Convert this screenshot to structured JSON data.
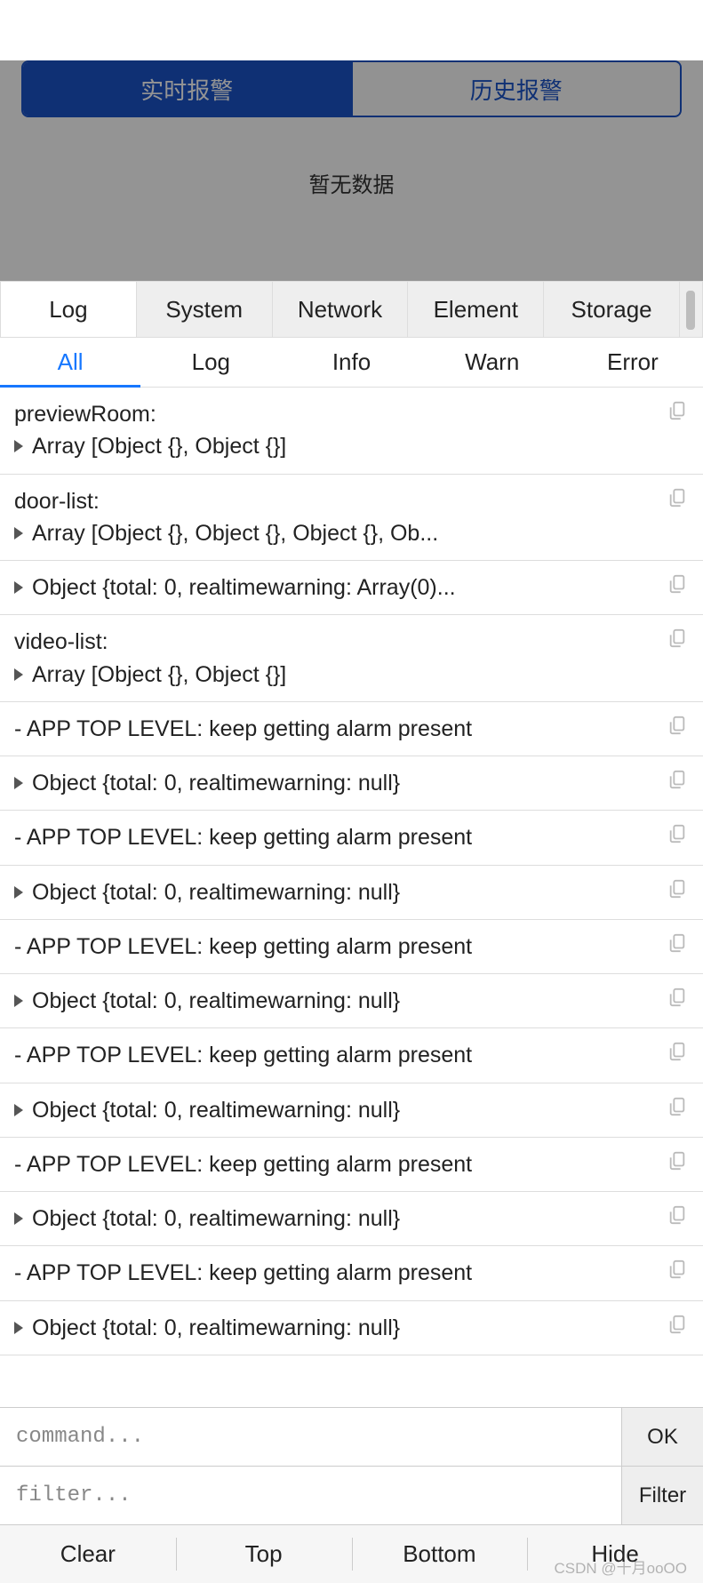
{
  "header": {
    "tabs": [
      "实时报警",
      "历史报警"
    ],
    "activeIndex": 0,
    "noData": "暂无数据"
  },
  "console": {
    "mainTabs": [
      "Log",
      "System",
      "Network",
      "Element",
      "Storage"
    ],
    "mainActiveIndex": 0,
    "subTabs": [
      "All",
      "Log",
      "Info",
      "Warn",
      "Error"
    ],
    "subActiveIndex": 0
  },
  "logs": [
    {
      "label": "previewRoom:",
      "expand": true,
      "body": "Array [Object {}, Object {}]"
    },
    {
      "label": "door-list:",
      "expand": true,
      "body": "Array [Object {}, Object {}, Object {}, Ob..."
    },
    {
      "expand": true,
      "body": "Object {total: 0, realtimewarning: Array(0)..."
    },
    {
      "label": "video-list:",
      "expand": true,
      "body": "Array [Object {}, Object {}]"
    },
    {
      "body": "- APP TOP LEVEL: keep getting alarm present"
    },
    {
      "expand": true,
      "body": "Object {total: 0, realtimewarning: null}"
    },
    {
      "body": "- APP TOP LEVEL: keep getting alarm present"
    },
    {
      "expand": true,
      "body": "Object {total: 0, realtimewarning: null}"
    },
    {
      "body": "- APP TOP LEVEL: keep getting alarm present"
    },
    {
      "expand": true,
      "body": "Object {total: 0, realtimewarning: null}"
    },
    {
      "body": "- APP TOP LEVEL: keep getting alarm present"
    },
    {
      "expand": true,
      "body": "Object {total: 0, realtimewarning: null}"
    },
    {
      "body": "- APP TOP LEVEL: keep getting alarm present"
    },
    {
      "expand": true,
      "body": "Object {total: 0, realtimewarning: null}"
    },
    {
      "body": "- APP TOP LEVEL: keep getting alarm present"
    },
    {
      "expand": true,
      "body": "Object {total: 0, realtimewarning: null}"
    }
  ],
  "inputs": {
    "commandPlaceholder": "command...",
    "filterPlaceholder": "filter...",
    "okLabel": "OK",
    "filterLabel": "Filter"
  },
  "bottomBar": [
    "Clear",
    "Top",
    "Bottom",
    "Hide"
  ],
  "watermark": "CSDN @十月ooOO"
}
